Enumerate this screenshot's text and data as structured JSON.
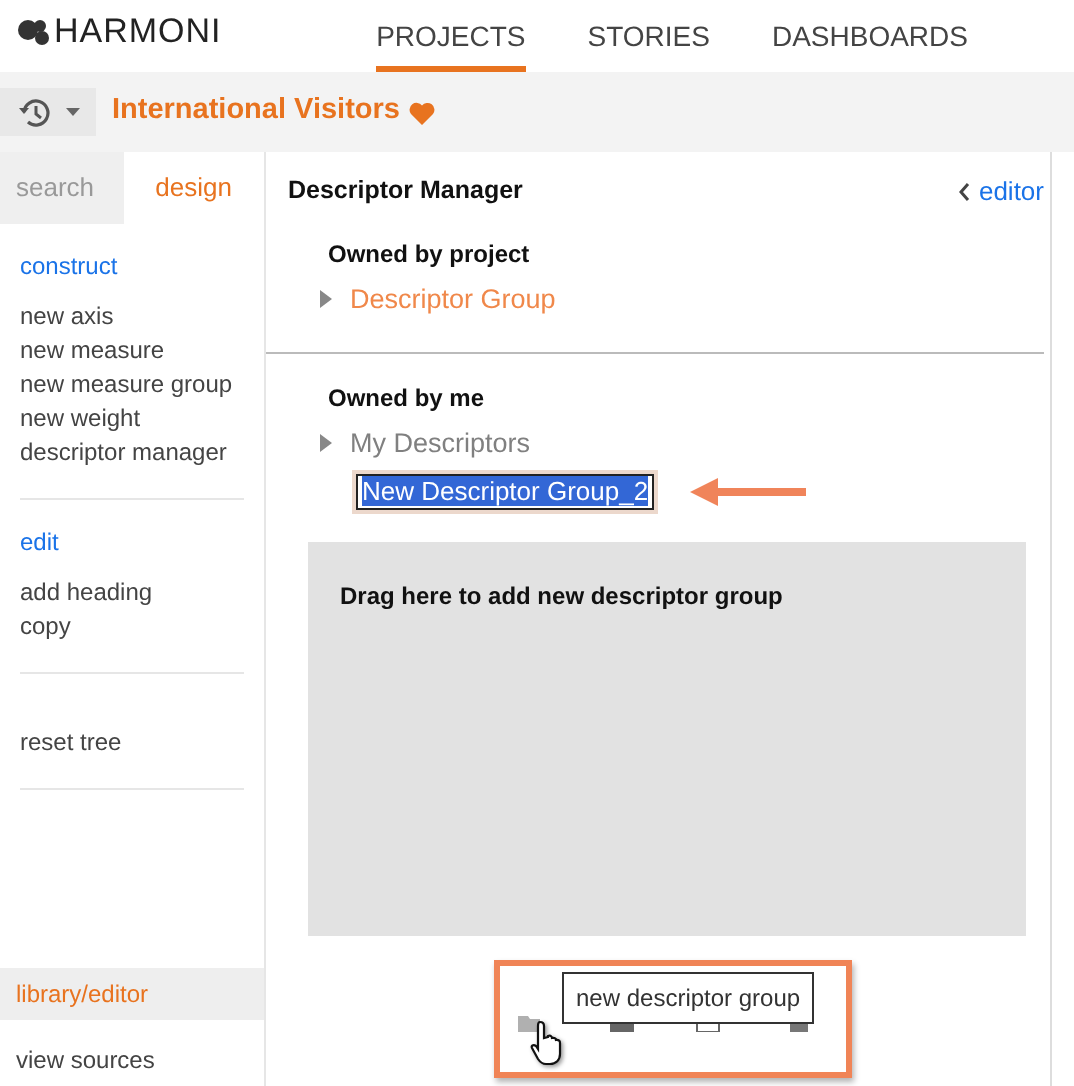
{
  "brand": "HARMONI",
  "nav": [
    {
      "label": "PROJECTS",
      "selected": true
    },
    {
      "label": "STORIES",
      "selected": false
    },
    {
      "label": "DASHBOARDS",
      "selected": false
    }
  ],
  "project": {
    "title": "International Visitors",
    "favorite": true
  },
  "sidebar": {
    "tabs": [
      {
        "label": "search",
        "selected": false
      },
      {
        "label": "design",
        "selected": true
      }
    ],
    "sections": [
      {
        "heading": "construct",
        "items": [
          "new axis",
          "new measure",
          "new measure group",
          "new weight",
          "descriptor manager"
        ]
      },
      {
        "heading": "edit",
        "items": [
          "add heading",
          "copy"
        ]
      },
      {
        "items": [
          "reset tree"
        ]
      }
    ],
    "footer": [
      {
        "label": "library/editor",
        "selected": true
      },
      {
        "label": "view sources",
        "selected": false
      }
    ]
  },
  "manager": {
    "title": "Descriptor Manager",
    "back_link": "editor",
    "groups": [
      {
        "heading": "Owned by project",
        "items": [
          {
            "label": "Descriptor Group",
            "color": "#f0884a"
          }
        ]
      },
      {
        "heading": "Owned by me",
        "items": [
          {
            "label": "My Descriptors",
            "color": "#808080"
          }
        ],
        "new_item": {
          "value": "New Descriptor Group_2"
        }
      }
    ],
    "drop_zone": "Drag here to add new descriptor group",
    "tooltip": "new descriptor group"
  }
}
